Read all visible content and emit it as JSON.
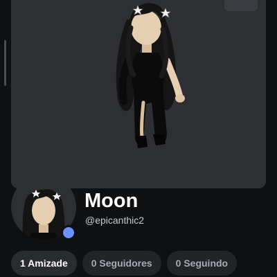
{
  "profile": {
    "display_name": "Moon",
    "username": "@epicanthic2",
    "presence_color": "#6e8fff"
  },
  "stats": [
    {
      "label": "1 Amizade",
      "active": true
    },
    {
      "label": "0 Seguidores",
      "active": false
    },
    {
      "label": "0 Seguindo",
      "active": false
    }
  ],
  "icons": {
    "hair_accessory": "star-clip-icon",
    "presence": "online-dot"
  }
}
